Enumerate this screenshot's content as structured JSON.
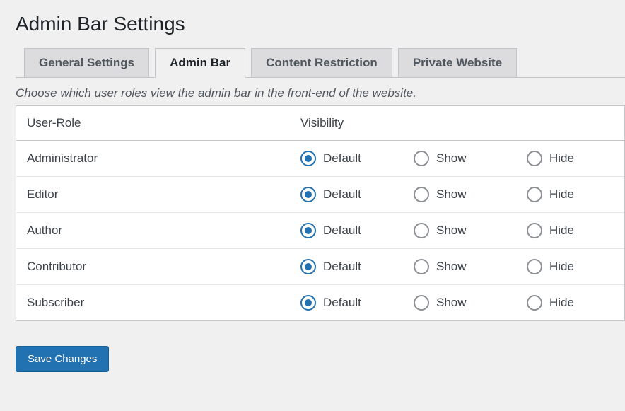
{
  "page_title": "Admin Bar Settings",
  "tabs": [
    {
      "label": "General Settings",
      "active": false
    },
    {
      "label": "Admin Bar",
      "active": true
    },
    {
      "label": "Content Restriction",
      "active": false
    },
    {
      "label": "Private Website",
      "active": false
    }
  ],
  "description": "Choose which user roles view the admin bar in the front-end of the website.",
  "table": {
    "headers": {
      "role": "User-Role",
      "visibility": "Visibility"
    },
    "options": {
      "default": "Default",
      "show": "Show",
      "hide": "Hide"
    },
    "rows": [
      {
        "role": "Administrator",
        "selected": "default"
      },
      {
        "role": "Editor",
        "selected": "default"
      },
      {
        "role": "Author",
        "selected": "default"
      },
      {
        "role": "Contributor",
        "selected": "default"
      },
      {
        "role": "Subscriber",
        "selected": "default"
      }
    ]
  },
  "save_label": "Save Changes"
}
